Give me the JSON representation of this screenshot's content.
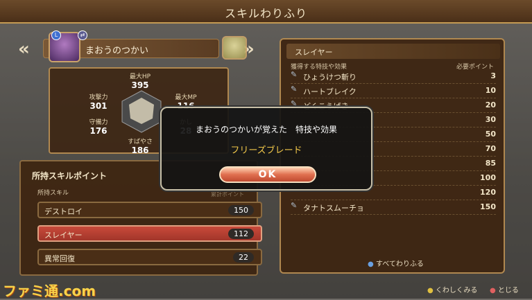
{
  "screen_title": "スキルわりふり",
  "character": {
    "name": "まおうのつかい"
  },
  "stats": {
    "hp": {
      "label": "最大HP",
      "value": "395"
    },
    "mp": {
      "label": "最大MP",
      "value": "116"
    },
    "atk": {
      "label": "攻撃力",
      "value": "301"
    },
    "def": {
      "label": "守備力",
      "value": "176"
    },
    "spd": {
      "label": "すばやさ",
      "value": "186"
    },
    "wis": {
      "label": "かし",
      "value": "28"
    }
  },
  "skill_points": {
    "header": "所持スキルポイント",
    "subheader": "所持スキル",
    "subheader_right": "累計ポイント",
    "rows": [
      {
        "label": "デストロイ",
        "value": "150"
      },
      {
        "label": "スレイヤー",
        "value": "112"
      },
      {
        "label": "異常回復",
        "value": "22"
      }
    ]
  },
  "skill_tree": {
    "title": "スレイヤー",
    "col_left": "獲得する特技や効果",
    "col_right": "必要ポイント",
    "items": [
      {
        "name": "ひょうけつ斬り",
        "points": "3"
      },
      {
        "name": "ハートブレイク",
        "points": "10"
      },
      {
        "name": "どくこうげき",
        "points": "20"
      },
      {
        "name": "",
        "points": "30"
      },
      {
        "name": "",
        "points": "50"
      },
      {
        "name": "",
        "points": "70"
      },
      {
        "name": "",
        "points": "85"
      },
      {
        "name": "",
        "points": "100"
      },
      {
        "name": "",
        "points": "120"
      },
      {
        "name": "タナトスムーチョ",
        "points": "150"
      }
    ],
    "all_button": "すべてわりふる"
  },
  "dialog": {
    "message": "まおうのつかいが覚えた　特技や効果",
    "skill": "フリーズブレード",
    "ok": "OK"
  },
  "footer": {
    "details": "くわしくみる",
    "close": "とじる"
  },
  "watermark": "ファミ通.com"
}
